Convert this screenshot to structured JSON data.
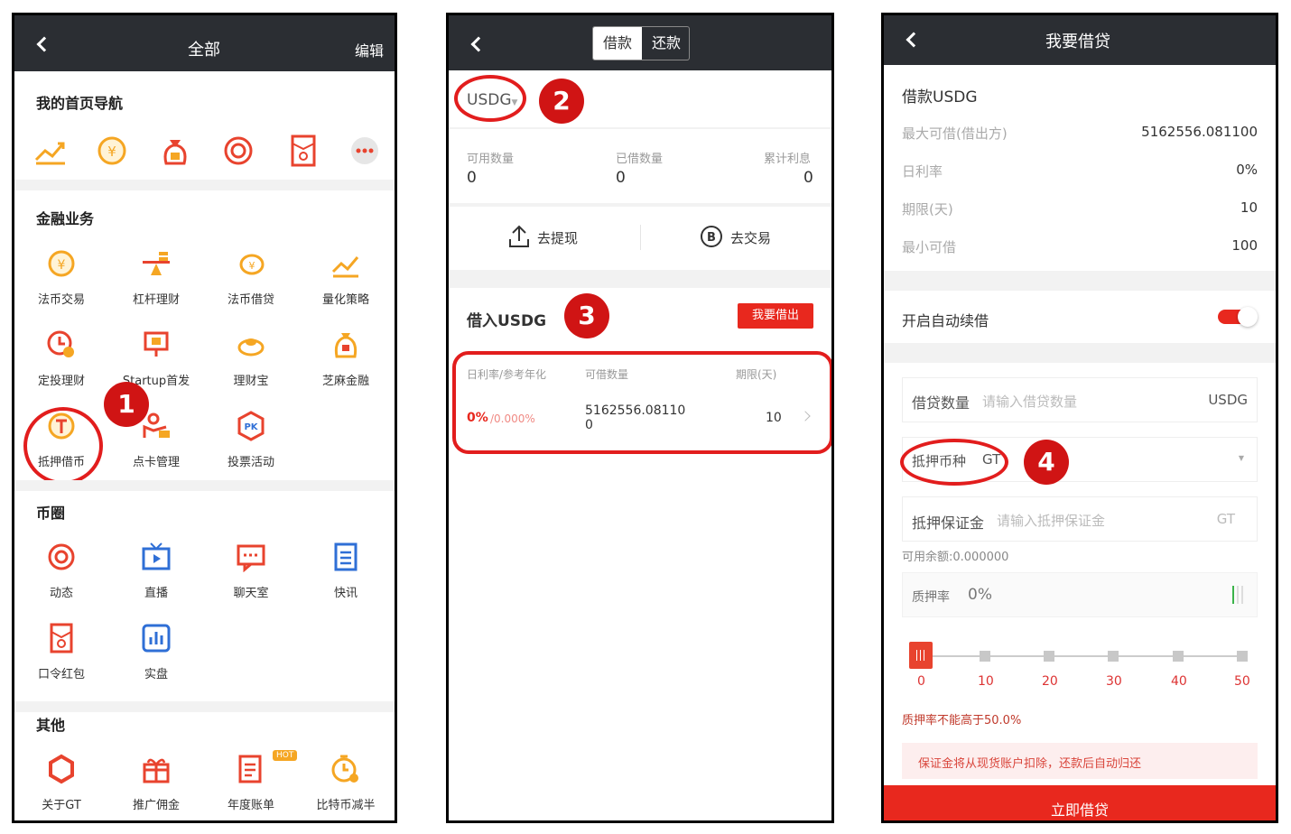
{
  "screen1": {
    "title": "全部",
    "edit": "编辑",
    "section_nav": "我的首页导航",
    "section_finance": "金融业务",
    "section_coin": "币圈",
    "section_other": "其他",
    "finance_items": [
      "法币交易",
      "杠杆理财",
      "法币借贷",
      "量化策略",
      "定投理财",
      "Startup首发",
      "理财宝",
      "芝麻金融",
      "抵押借币",
      "点卡管理",
      "投票活动"
    ],
    "coin_items": [
      "动态",
      "直播",
      "聊天室",
      "快讯",
      "口令红包",
      "实盘"
    ],
    "other_items": [
      "关于GT",
      "推广佣金",
      "年度账单",
      "比特币减半"
    ],
    "hot_badge": "HOT",
    "badge": "1"
  },
  "screen2": {
    "tab_borrow": "借款",
    "tab_repay": "还款",
    "currency": "USDG",
    "stats": [
      {
        "label": "可用数量",
        "value": "0"
      },
      {
        "label": "已借数量",
        "value": "0"
      },
      {
        "label": "累计利息",
        "value": "0"
      }
    ],
    "withdraw": "去提现",
    "trade": "去交易",
    "borrow_title": "借入USDG",
    "lend_button": "我要借出",
    "col_rate": "日利率/参考年化",
    "col_amount": "可借数量",
    "col_term": "期限(天)",
    "row_rate": "0%",
    "row_annual": "/0.000%",
    "row_amount_1": "5162556.08110",
    "row_amount_2": "0",
    "row_term": "10",
    "badge2": "2",
    "badge3": "3"
  },
  "screen3": {
    "title": "我要借贷",
    "borrow_coin": "借款USDG",
    "rows": [
      {
        "label": "最大可借(借出方)",
        "value": "5162556.081100"
      },
      {
        "label": "日利率",
        "value": "0%"
      },
      {
        "label": "期限(天)",
        "value": "10"
      },
      {
        "label": "最小可借",
        "value": "100"
      }
    ],
    "auto_renew": "开启自动续借",
    "qty_label": "借贷数量",
    "qty_placeholder": "请输入借贷数量",
    "qty_unit": "USDG",
    "collateral_label": "抵押币种",
    "collateral_value": "GT",
    "deposit_label": "抵押保证金",
    "deposit_placeholder": "请输入抵押保证金",
    "deposit_unit": "GT",
    "available": "可用余额:0.000000",
    "pledge_label": "质押率",
    "pledge_value": "0%",
    "slider_ticks": [
      "0",
      "10",
      "20",
      "30",
      "40",
      "50"
    ],
    "warning": "质押率不能高于50.0%",
    "notice": "保证金将从现货账户扣除，还款后自动归还",
    "submit": "立即借贷",
    "badge4": "4"
  },
  "colors": {
    "accent": "#e8281e",
    "dark_bar": "#2b2e33",
    "icon_orange": "#f5a623",
    "icon_red": "#e8432e",
    "icon_blue": "#2f6fd6"
  }
}
